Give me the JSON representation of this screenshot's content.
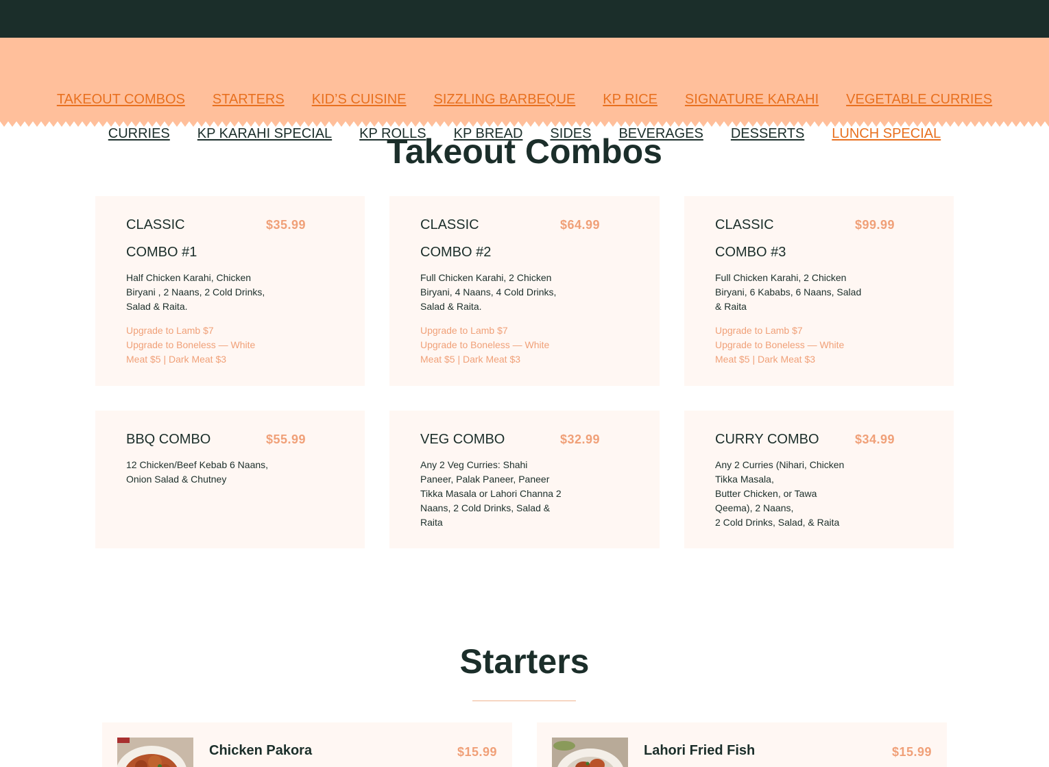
{
  "nav": {
    "row1": [
      {
        "label": "TAKEOUT COMBOS",
        "active": true
      },
      {
        "label": "STARTERS",
        "active": true
      },
      {
        "label": "KID’S CUISINE",
        "active": true
      },
      {
        "label": "SIZZLING BARBEQUE",
        "active": true
      },
      {
        "label": "KP RICE",
        "active": true
      },
      {
        "label": "SIGNATURE KARAHI",
        "active": true
      },
      {
        "label": "VEGETABLE CURRIES",
        "active": true
      }
    ],
    "row2": [
      {
        "label": "CURRIES",
        "active": false
      },
      {
        "label": "KP KARAHI SPECIAL",
        "active": false
      },
      {
        "label": "KP ROLLS",
        "active": false
      },
      {
        "label": "KP BREAD",
        "active": false
      },
      {
        "label": "SIDES",
        "active": false
      },
      {
        "label": "BEVERAGES",
        "active": false
      },
      {
        "label": "DESSERTS",
        "active": false
      },
      {
        "label": "LUNCH SPECIAL",
        "active": true
      }
    ]
  },
  "sections": {
    "takeout_title": "Takeout Combos",
    "starters_title": "Starters"
  },
  "combos": [
    {
      "name_line1": "CLASSIC",
      "name_line2": "COMBO #1",
      "price": "$35.99",
      "description": "Half Chicken Karahi, Chicken Biryani , 2 Naans, 2 Cold Drinks, Salad & Raita.",
      "upgrade_1": "Upgrade to Lamb $7",
      "upgrade_2": "Upgrade to Boneless — White Meat $5 | Dark Meat $3"
    },
    {
      "name_line1": "CLASSIC",
      "name_line2": "COMBO #2",
      "price": "$64.99",
      "description": "Full Chicken Karahi, 2 Chicken Biryani, 4 Naans, 4 Cold Drinks, Salad & Raita.",
      "upgrade_1": "Upgrade to Lamb $7",
      "upgrade_2": "Upgrade to Boneless — White Meat $5 | Dark Meat $3"
    },
    {
      "name_line1": "CLASSIC",
      "name_line2": "COMBO #3",
      "price": "$99.99",
      "description": "Full Chicken Karahi, 2 Chicken Biryani, 6 Kababs, 6 Naans, Salad & Raita",
      "upgrade_1": "Upgrade to Lamb $7",
      "upgrade_2": "Upgrade to Boneless — White Meat $5 | Dark Meat $3"
    },
    {
      "name_line1": "BBQ COMBO",
      "price": "$55.99",
      "description": "12 Chicken/Beef Kebab 6 Naans, Onion Salad & Chutney"
    },
    {
      "name_line1": "VEG COMBO",
      "price": "$32.99",
      "description": "Any 2 Veg Curries: Shahi Paneer, Palak Paneer, Paneer Tikka Masala or Lahori Channa 2 Naans, 2 Cold Drinks, Salad & Raita"
    },
    {
      "name_line1": "CURRY COMBO",
      "price": "$34.99",
      "description_line1": "Any 2 Curries (Nihari, Chicken Tikka Masala,",
      "description_line2": "Butter Chicken, or Tawa Qeema), 2 Naans,",
      "description_line3": "2 Cold Drinks, Salad, & Raita"
    }
  ],
  "starters": [
    {
      "name": "Chicken Pakora",
      "price": "$15.99"
    },
    {
      "name": "Lahori Fried Fish",
      "price": "$15.99"
    }
  ],
  "colors": {
    "dark": "#1b2e2a",
    "accent": "#e8701f",
    "peach": "#ffbf9b",
    "price": "#f0a078",
    "card": "#fff7f3"
  }
}
